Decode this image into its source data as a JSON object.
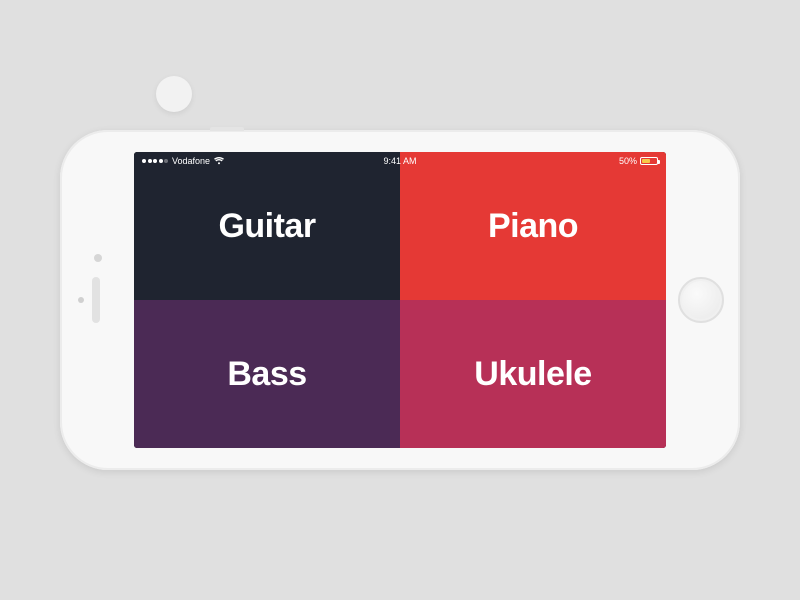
{
  "status_bar": {
    "carrier": "Vodafone",
    "time": "9:41 AM",
    "battery_percent": "50%"
  },
  "tiles": {
    "guitar": {
      "label": "Guitar"
    },
    "piano": {
      "label": "Piano"
    },
    "bass": {
      "label": "Bass"
    },
    "ukulele": {
      "label": "Ukulele"
    }
  },
  "colors": {
    "guitar": "#1f2430",
    "piano": "#e53935",
    "bass": "#4b2a55",
    "ukulele": "#b73057",
    "battery_fill": "#f7c948"
  }
}
